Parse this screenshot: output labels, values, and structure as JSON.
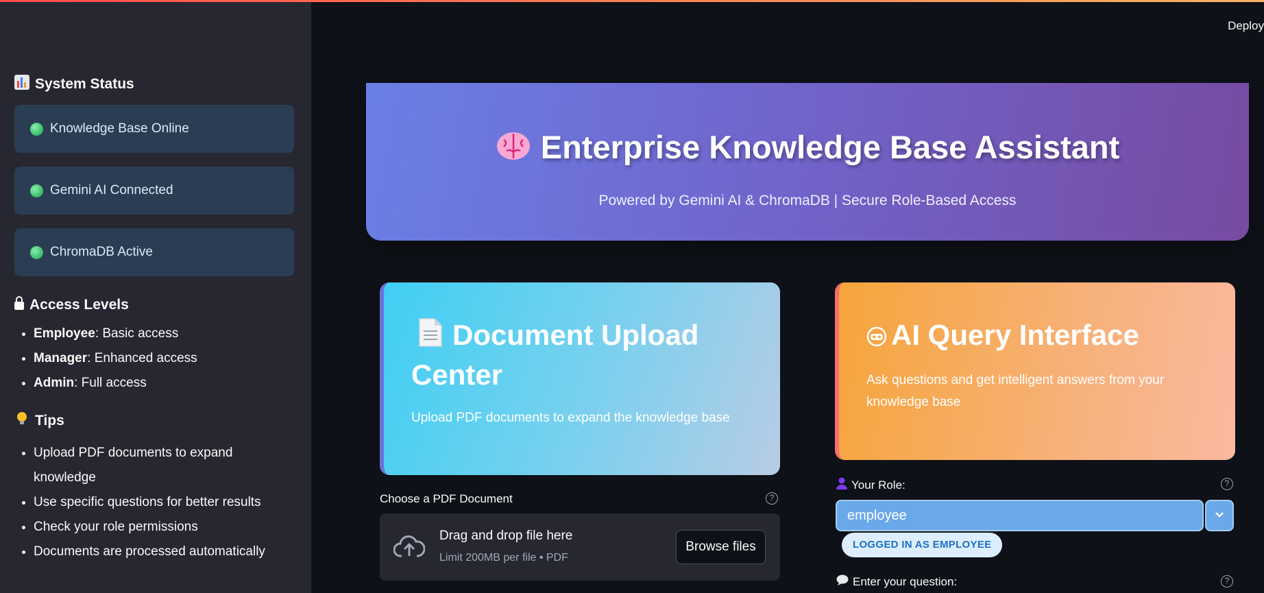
{
  "app": {
    "deploy_label": "Deploy"
  },
  "sidebar": {
    "status_title": "System Status",
    "status_items": [
      {
        "label": "Knowledge Base Online"
      },
      {
        "label": "Gemini AI Connected"
      },
      {
        "label": "ChromaDB Active"
      }
    ],
    "access_title": "Access Levels",
    "access_items": [
      {
        "role": "Employee",
        "desc": ": Basic access"
      },
      {
        "role": "Manager",
        "desc": ": Enhanced access"
      },
      {
        "role": "Admin",
        "desc": ": Full access"
      }
    ],
    "tips_title": "Tips",
    "tips": [
      "Upload PDF documents to expand knowledge",
      "Use specific questions for better results",
      "Check your role permissions",
      "Documents are processed automatically"
    ]
  },
  "hero": {
    "title": "Enterprise Knowledge Base Assistant",
    "subtitle": "Powered by Gemini AI & ChromaDB | Secure Role-Based Access"
  },
  "upload_card": {
    "title": "Document Upload Center",
    "description": "Upload PDF documents to expand the knowledge base"
  },
  "query_card": {
    "title": "AI Query Interface",
    "description": "Ask questions and get intelligent answers from your knowledge base"
  },
  "uploader": {
    "label": "Choose a PDF Document",
    "drop_title": "Drag and drop file here",
    "drop_limit": "Limit 200MB per file • PDF",
    "browse_label": "Browse files"
  },
  "role": {
    "label": "Your Role:",
    "selected": "employee",
    "badge": "LOGGED IN AS EMPLOYEE"
  },
  "question": {
    "label": "Enter your question:"
  },
  "colors": {
    "background": "#0e1117",
    "sidebar": "#262730",
    "status_box": "#2b3d52",
    "hero_start": "#6a7fe6",
    "hero_end": "#764ba2",
    "upload_start": "#3fcff3",
    "query_start": "#f6a53b",
    "select": "#6aa9e9"
  },
  "icons": {
    "status": "bar-chart-icon",
    "access": "lock-icon",
    "tips": "lightbulb-icon",
    "hero": "brain-icon",
    "upload": "document-icon",
    "query": "robot-icon",
    "role": "person-icon",
    "question": "speech-bubble-icon",
    "drop": "cloud-upload-icon"
  }
}
